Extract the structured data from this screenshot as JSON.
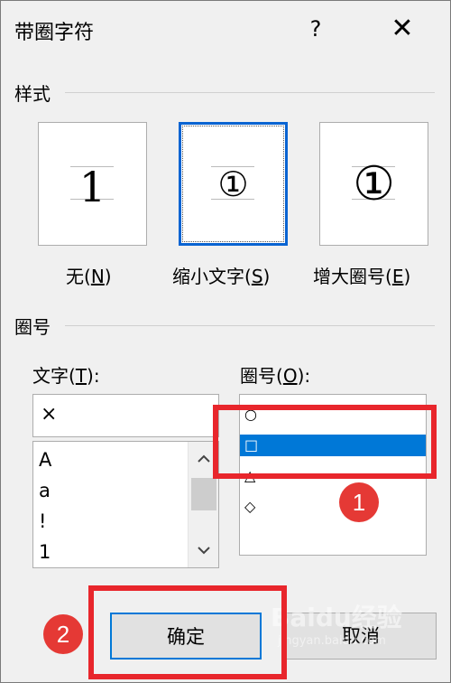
{
  "dialog": {
    "title": "带圈字符",
    "help_label": "?",
    "close_label": "✕"
  },
  "style_group": {
    "label": "样式",
    "options": [
      {
        "preview": "1",
        "label": "无(",
        "accel": "N",
        "label_end": ")"
      },
      {
        "preview": "①",
        "label": "缩小文字(",
        "accel": "S",
        "label_end": ")"
      },
      {
        "preview": "①",
        "label": "增大圈号(",
        "accel": "E",
        "label_end": ")"
      }
    ],
    "selected_index": 1
  },
  "enclosure_group": {
    "label": "圈号",
    "text_field": {
      "label": "文字(",
      "accel": "T",
      "label_end": "):",
      "value": "×",
      "list_items": [
        "A",
        "a",
        "!",
        "1"
      ]
    },
    "enclosure_field": {
      "label": "圈号(",
      "accel": "O",
      "label_end": "):",
      "items": [
        "○",
        "□",
        "△",
        "◇"
      ],
      "selected_index": 1
    }
  },
  "scroll_icons": {
    "up": "chevron-up-icon",
    "down": "chevron-down-icon"
  },
  "annotations": {
    "badge_1": "1",
    "badge_2": "2",
    "highlight_color": "#e8262c"
  },
  "buttons": {
    "ok_label": "确定",
    "cancel_label": "取消"
  },
  "watermark": {
    "main": "Baidu经验",
    "sub": "jingyan.baidu.com"
  },
  "colors": {
    "selection_blue": "#0078d7",
    "focus_border": "#0a64d2",
    "dialog_bg": "#f0f0f0"
  }
}
